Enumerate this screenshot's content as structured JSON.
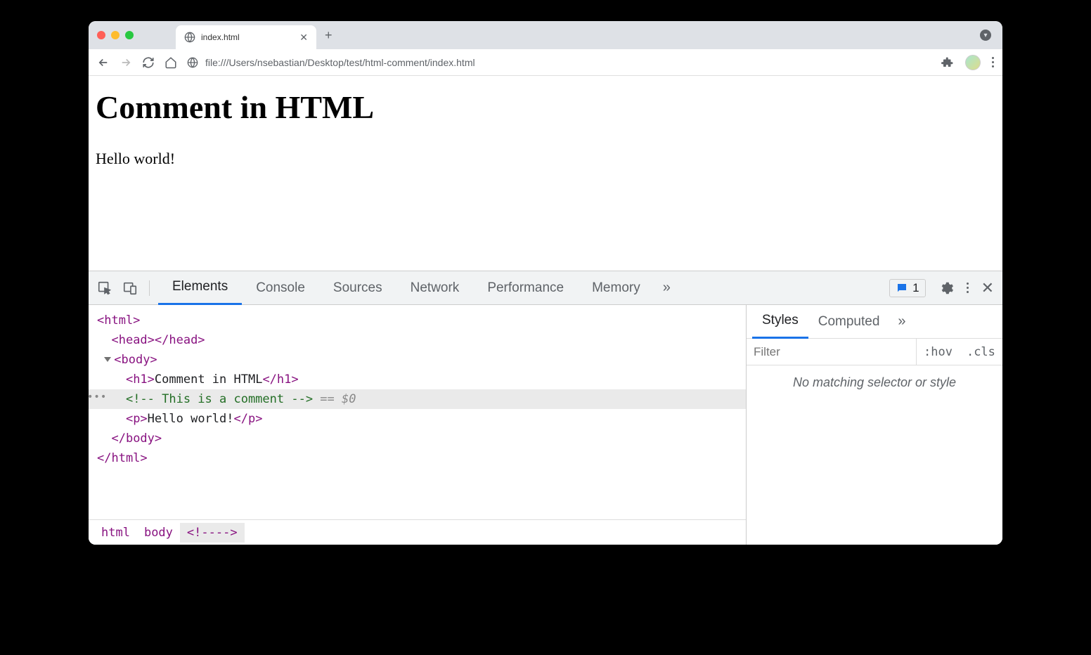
{
  "browser": {
    "tab_title": "index.html",
    "url": "file:///Users/nsebastian/Desktop/test/html-comment/index.html"
  },
  "page": {
    "heading": "Comment in HTML",
    "paragraph": "Hello world!"
  },
  "devtools": {
    "tabs": [
      "Elements",
      "Console",
      "Sources",
      "Network",
      "Performance",
      "Memory"
    ],
    "active_tab": "Elements",
    "message_count": "1",
    "dom": {
      "html_open": "<html>",
      "head": "<head></head>",
      "body_open": "<body>",
      "h1_open": "<h1>",
      "h1_text": "Comment in HTML",
      "h1_close": "</h1>",
      "comment": "<!-- This is a comment -->",
      "eq": " == ",
      "zero": "$0",
      "p_open": "<p>",
      "p_text": "Hello world!",
      "p_close": "</p>",
      "body_close": "</body>",
      "html_close": "</html>"
    },
    "breadcrumb": [
      "html",
      "body",
      "<!--​-->"
    ],
    "styles": {
      "tabs": [
        "Styles",
        "Computed"
      ],
      "active_tab": "Styles",
      "filter_placeholder": "Filter",
      "hov": ":hov",
      "cls": ".cls",
      "empty_message": "No matching selector or style"
    }
  }
}
